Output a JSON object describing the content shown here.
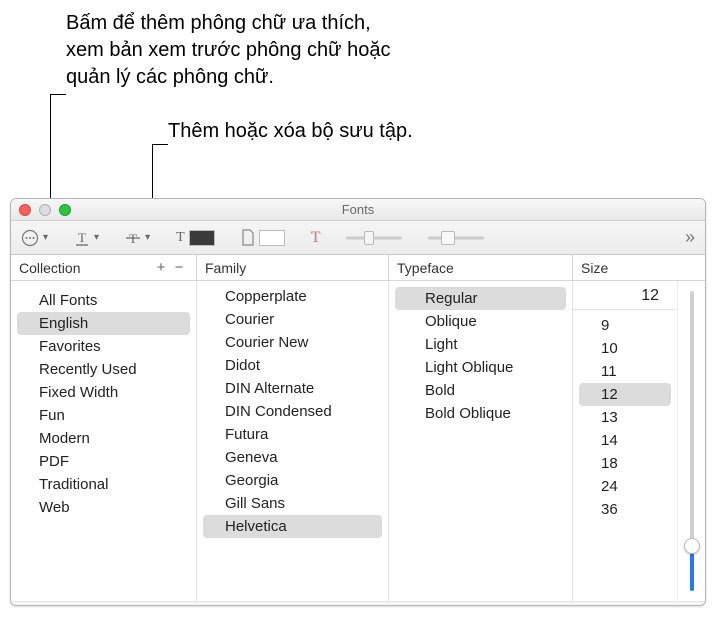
{
  "callouts": {
    "action_menu": "Bấm để thêm phông chữ ưa thích, xem bản xem trước phông chữ hoặc quản lý các phông chữ.",
    "add_remove": "Thêm hoặc xóa bộ sưu tập."
  },
  "window": {
    "title": "Fonts"
  },
  "toolbar": {
    "action_menu_icon": "more-actions",
    "underline_icon": "T",
    "strikethrough_icon": "T",
    "text_color_icon": "T",
    "text_color_swatch": "#3a3a3a",
    "doc_color_icon": "page",
    "doc_color_swatch": "#ffffff",
    "shadow_icon": "T",
    "overflow_icon": "»"
  },
  "headers": {
    "collection": "Collection",
    "family": "Family",
    "typeface": "Typeface",
    "size": "Size"
  },
  "collections": {
    "items": [
      {
        "label": "All Fonts"
      },
      {
        "label": "English",
        "selected": true
      },
      {
        "label": "Favorites"
      },
      {
        "label": "Recently Used"
      },
      {
        "label": "Fixed Width"
      },
      {
        "label": "Fun"
      },
      {
        "label": "Modern"
      },
      {
        "label": "PDF"
      },
      {
        "label": "Traditional"
      },
      {
        "label": "Web"
      }
    ]
  },
  "families": {
    "items": [
      {
        "label": "Copperplate"
      },
      {
        "label": "Courier"
      },
      {
        "label": "Courier New"
      },
      {
        "label": "Didot"
      },
      {
        "label": "DIN Alternate"
      },
      {
        "label": "DIN Condensed"
      },
      {
        "label": "Futura"
      },
      {
        "label": "Geneva"
      },
      {
        "label": "Georgia"
      },
      {
        "label": "Gill Sans"
      },
      {
        "label": "Helvetica",
        "selected": true
      }
    ]
  },
  "typefaces": {
    "items": [
      {
        "label": "Regular",
        "selected": true
      },
      {
        "label": "Oblique"
      },
      {
        "label": "Light"
      },
      {
        "label": "Light Oblique"
      },
      {
        "label": "Bold"
      },
      {
        "label": "Bold Oblique"
      }
    ]
  },
  "size": {
    "current": "12",
    "options": [
      {
        "label": "9"
      },
      {
        "label": "10"
      },
      {
        "label": "11"
      },
      {
        "label": "12",
        "selected": true
      },
      {
        "label": "13"
      },
      {
        "label": "14"
      },
      {
        "label": "18"
      },
      {
        "label": "24"
      },
      {
        "label": "36"
      }
    ],
    "slider_position_pct": 15
  }
}
